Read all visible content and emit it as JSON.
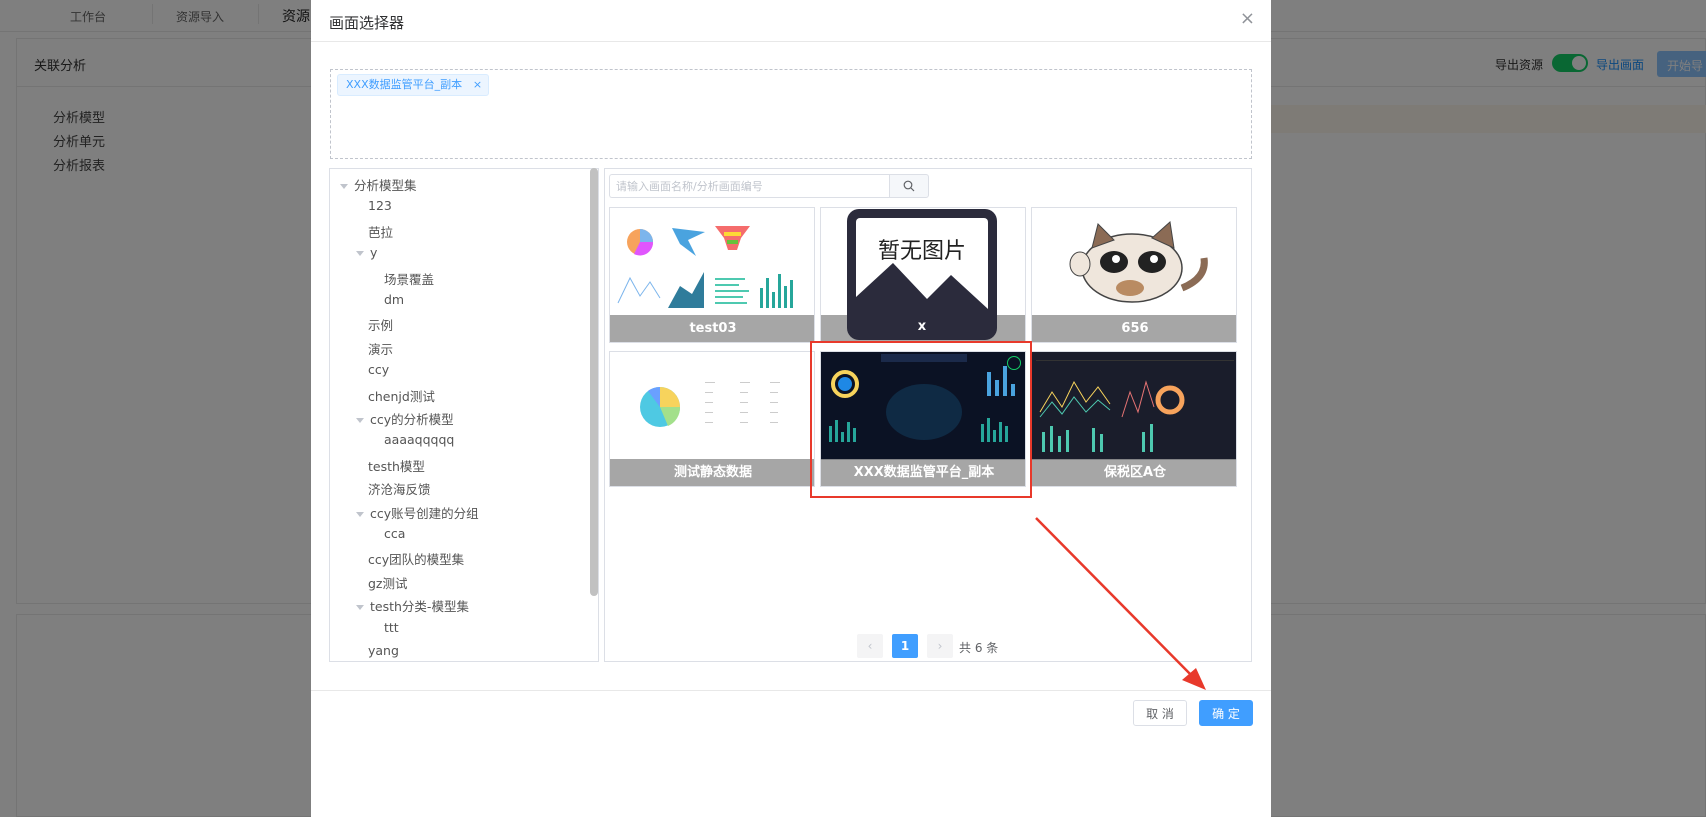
{
  "background": {
    "nav_tabs": [
      "工作台",
      "资源导入",
      "资源"
    ],
    "page_title": "关联分析",
    "export_label": "导出资源",
    "export_link": "导出画面",
    "start_button": "开始导",
    "menu": [
      "分析模型",
      "分析单元",
      "分析报表"
    ]
  },
  "dialog": {
    "title": "画面选择器",
    "selected_tag": "XXX数据监管平台_副本",
    "tree": [
      {
        "label": "分析模型集",
        "level": 0,
        "expanded": true
      },
      {
        "label": "123",
        "level": 1
      },
      {
        "label": "芭拉",
        "level": 1
      },
      {
        "label": "y",
        "level": 1,
        "expanded": true
      },
      {
        "label": "场景覆盖",
        "level": 2
      },
      {
        "label": "dm",
        "level": 2
      },
      {
        "label": "示例",
        "level": 1
      },
      {
        "label": "演示",
        "level": 1
      },
      {
        "label": "ccy",
        "level": 1
      },
      {
        "label": "chenjd测试",
        "level": 1
      },
      {
        "label": "ccy的分析模型",
        "level": 1,
        "expanded": true
      },
      {
        "label": "aaaaqqqqq",
        "level": 2
      },
      {
        "label": "testh模型",
        "level": 1
      },
      {
        "label": "济沧海反馈",
        "level": 1
      },
      {
        "label": "ccy账号创建的分组",
        "level": 1,
        "expanded": true
      },
      {
        "label": "cca",
        "level": 2
      },
      {
        "label": "ccy团队的模型集",
        "level": 1
      },
      {
        "label": "gz测试",
        "level": 1
      },
      {
        "label": "testh分类-模型集",
        "level": 1,
        "expanded": true
      },
      {
        "label": "ttt",
        "level": 2
      },
      {
        "label": "yang",
        "level": 1
      }
    ],
    "search_placeholder": "请输入画面名称/分析画面编号",
    "cards": [
      {
        "label": "test03",
        "thumb": "charts-light"
      },
      {
        "label": "x",
        "thumb": "no-image"
      },
      {
        "label": "656",
        "thumb": "cat"
      },
      {
        "label": "测试静态数据",
        "thumb": "pie-table"
      },
      {
        "label": "XXX数据监管平台_副本",
        "thumb": "dashboard-dark",
        "selected": true
      },
      {
        "label": "保税区A仓",
        "thumb": "dashboard-dark2"
      }
    ],
    "no_image_text": "暂无图片",
    "pagination": {
      "current": "1",
      "total_text": "共 6 条",
      "prev": "‹",
      "next": "›"
    },
    "cancel": "取 消",
    "confirm": "确 定"
  },
  "colors": {
    "primary": "#409eff",
    "highlight": "#e8392b",
    "toggle_on": "#13ce66"
  }
}
